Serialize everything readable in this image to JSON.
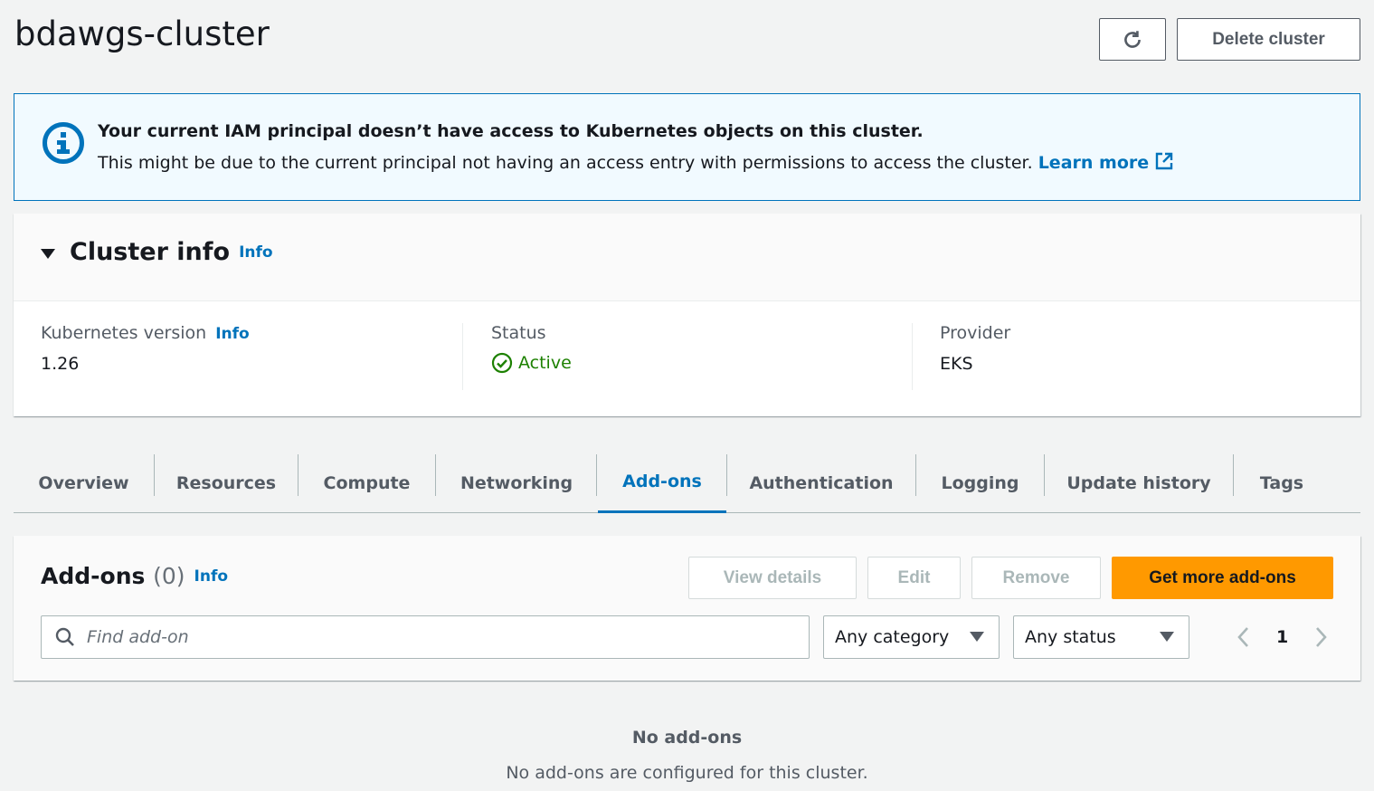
{
  "header": {
    "title": "bdawgs-cluster",
    "delete_label": "Delete cluster"
  },
  "alert": {
    "title": "Your current IAM principal doesn’t have access to Kubernetes objects on this cluster.",
    "body": "This might be due to the current principal not having an access entry with permissions to access the cluster.",
    "link": "Learn more"
  },
  "cluster_info": {
    "title": "Cluster info",
    "info": "Info",
    "kubernetes_version_label": "Kubernetes version",
    "kubernetes_version_info": "Info",
    "kubernetes_version": "1.26",
    "status_label": "Status",
    "status": "Active",
    "provider_label": "Provider",
    "provider": "EKS"
  },
  "tabs": [
    {
      "label": "Overview"
    },
    {
      "label": "Resources"
    },
    {
      "label": "Compute"
    },
    {
      "label": "Networking"
    },
    {
      "label": "Add-ons"
    },
    {
      "label": "Authentication"
    },
    {
      "label": "Logging"
    },
    {
      "label": "Update history"
    },
    {
      "label": "Tags"
    }
  ],
  "addons": {
    "title": "Add-ons",
    "count": "(0)",
    "info": "Info",
    "view_details": "View details",
    "edit": "Edit",
    "remove": "Remove",
    "get_more": "Get more add-ons",
    "search_placeholder": "Find add-on",
    "category": "Any category",
    "status": "Any status",
    "page": "1",
    "empty_title": "No add-ons",
    "empty_body": "No add-ons are configured for this cluster."
  },
  "colors": {
    "accent": "#0073bb",
    "primary_button": "#ff9900",
    "success": "#1d8102"
  }
}
